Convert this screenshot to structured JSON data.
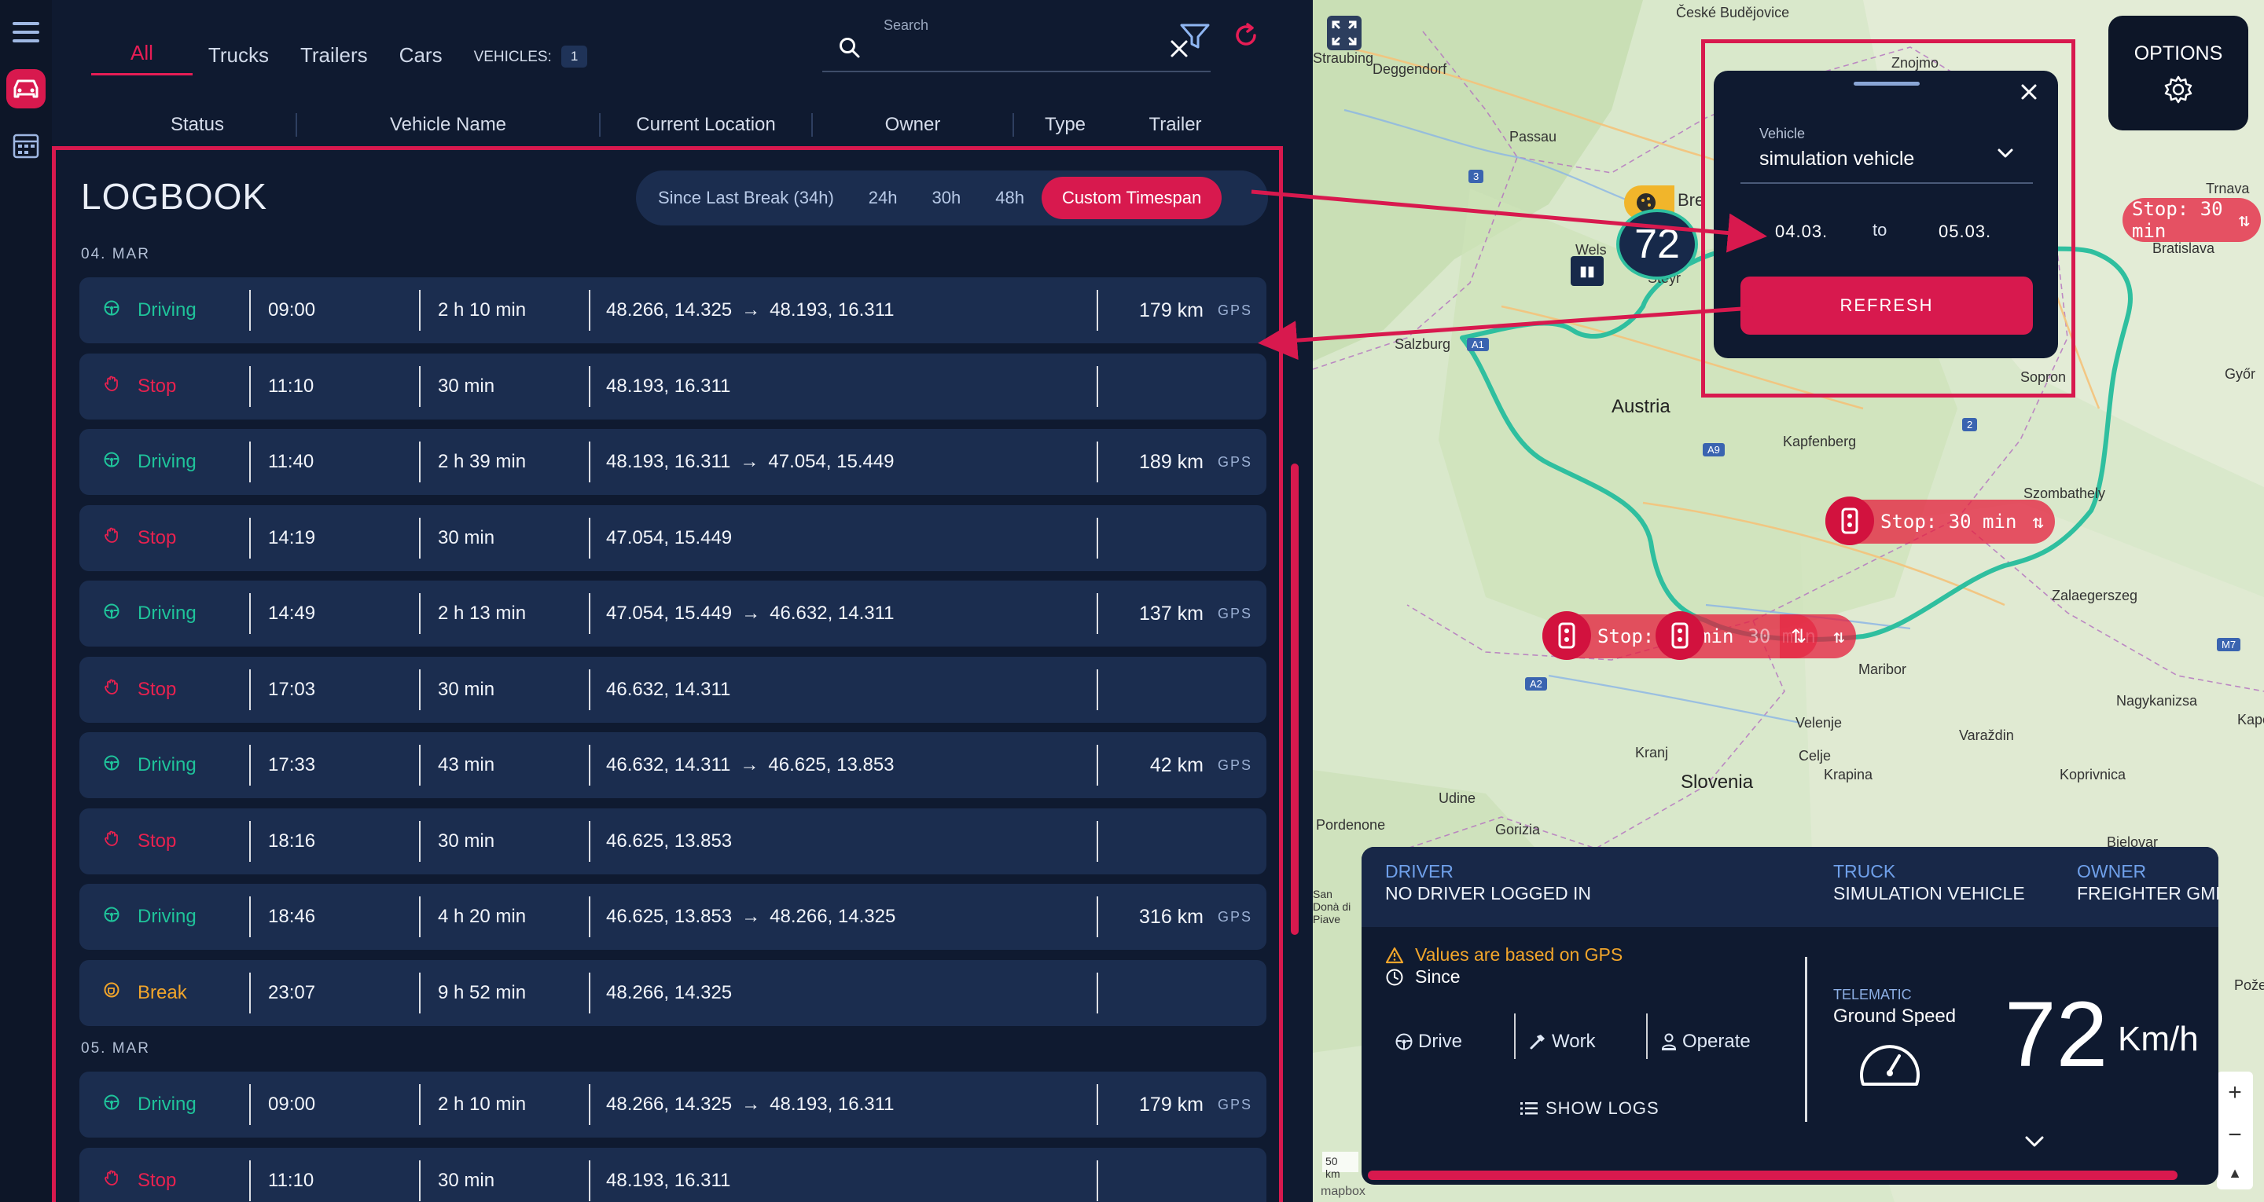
{
  "nav": {
    "tabs": [
      {
        "label": "All",
        "active": true
      },
      {
        "label": "Trucks"
      },
      {
        "label": "Trailers"
      },
      {
        "label": "Cars"
      }
    ],
    "vehicles_label": "VEHICLES:",
    "vehicles_count": "1"
  },
  "search": {
    "label": "Search",
    "value": ""
  },
  "columns": [
    "Status",
    "Vehicle Name",
    "Current Location",
    "Owner",
    "Type",
    "Trailer"
  ],
  "logbook": {
    "title": "LOGBOOK",
    "timespans": [
      {
        "label": "Since Last Break (34h)"
      },
      {
        "label": "24h"
      },
      {
        "label": "30h"
      },
      {
        "label": "48h"
      },
      {
        "label": "Custom Timespan",
        "active": true
      }
    ],
    "days": [
      {
        "label": "04. MAR",
        "entries": [
          {
            "status": "Driving",
            "time": "09:00",
            "duration": "2 h 10 min",
            "from": "48.266, 14.325",
            "to": "48.193, 16.311",
            "distance": "179 km",
            "source": "GPS"
          },
          {
            "status": "Stop",
            "time": "11:10",
            "duration": "30 min",
            "from": "48.193, 16.311"
          },
          {
            "status": "Driving",
            "time": "11:40",
            "duration": "2 h 39 min",
            "from": "48.193, 16.311",
            "to": "47.054, 15.449",
            "distance": "189 km",
            "source": "GPS"
          },
          {
            "status": "Stop",
            "time": "14:19",
            "duration": "30 min",
            "from": "47.054, 15.449"
          },
          {
            "status": "Driving",
            "time": "14:49",
            "duration": "2 h 13 min",
            "from": "47.054, 15.449",
            "to": "46.632, 14.311",
            "distance": "137 km",
            "source": "GPS"
          },
          {
            "status": "Stop",
            "time": "17:03",
            "duration": "30 min",
            "from": "46.632, 14.311"
          },
          {
            "status": "Driving",
            "time": "17:33",
            "duration": "43 min",
            "from": "46.632, 14.311",
            "to": "46.625, 13.853",
            "distance": "42 km",
            "source": "GPS"
          },
          {
            "status": "Stop",
            "time": "18:16",
            "duration": "30 min",
            "from": "46.625, 13.853"
          },
          {
            "status": "Driving",
            "time": "18:46",
            "duration": "4 h 20 min",
            "from": "46.625, 13.853",
            "to": "48.266, 14.325",
            "distance": "316 km",
            "source": "GPS"
          },
          {
            "status": "Break",
            "time": "23:07",
            "duration": "9 h 52 min",
            "from": "48.266, 14.325"
          }
        ]
      },
      {
        "label": "05. MAR",
        "entries": [
          {
            "status": "Driving",
            "time": "09:00",
            "duration": "2 h 10 min",
            "from": "48.266, 14.325",
            "to": "48.193, 16.311",
            "distance": "179 km",
            "source": "GPS"
          },
          {
            "status": "Stop",
            "time": "11:10",
            "duration": "30 min",
            "from": "48.193, 16.311"
          }
        ]
      }
    ]
  },
  "map": {
    "labels": [
      "České Budějovice",
      "Straubing",
      "Deggendorf",
      "Znojmo",
      "Passau",
      "Wels",
      "Steyr",
      "Salzburg",
      "Austria",
      "Trnava",
      "Bratislava",
      "Kapfenberg",
      "Sopron",
      "Győr",
      "Szombathely",
      "Zalaegerszeg",
      "Maribor",
      "Velenje",
      "Celje",
      "Kranj",
      "Slovenia",
      "Udine",
      "Pordenone",
      "Gorizia",
      "Krapina",
      "Varaždin",
      "Koprivnica",
      "Nagykanizsa",
      "Bjelovar",
      "Požega",
      "San Donà di Piave",
      "Kapo"
    ],
    "road_shields": [
      "3",
      "A9",
      "A2",
      "A1",
      "2",
      "M7"
    ],
    "stop_markers": [
      "Stop: 30 min",
      "Stop: 30 min",
      "Stop: 30 min",
      "30 min",
      "Stop: 30 min"
    ],
    "speed_badge": "72",
    "truck_label": "Bre",
    "scale": "50 km",
    "attribution": "mapbox",
    "zoom_in": "+",
    "zoom_out": "−",
    "compass": "▲"
  },
  "options": {
    "label": "OPTIONS"
  },
  "timespan_popup": {
    "vehicle_label": "Vehicle",
    "vehicle_value": "simulation vehicle",
    "from": "04.03.",
    "to_label": "to",
    "until": "05.03.",
    "refresh": "REFRESH"
  },
  "info_card": {
    "driver_label": "DRIVER",
    "driver_value": "NO DRIVER LOGGED IN",
    "truck_label": "TRUCK",
    "truck_value": "SIMULATION VEHICLE",
    "owner_label": "OWNER",
    "owner_value": "FREIGHTER GMB",
    "warning": "Values are based on GPS",
    "since": "Since",
    "activities": [
      "Drive",
      "Work",
      "Operate"
    ],
    "show_logs": "SHOW LOGS",
    "telematic_label": "TELEMATIC",
    "telematic_title": "Ground Speed",
    "speed": "72",
    "speed_unit": "Km/h"
  },
  "colors": {
    "accent": "#d8194e",
    "driving": "#1fc39a",
    "stop": "#e8214f",
    "break": "#f1a52b",
    "panel": "#0f1a30",
    "row": "#1b2d4f",
    "route": "#2fbf9f"
  }
}
